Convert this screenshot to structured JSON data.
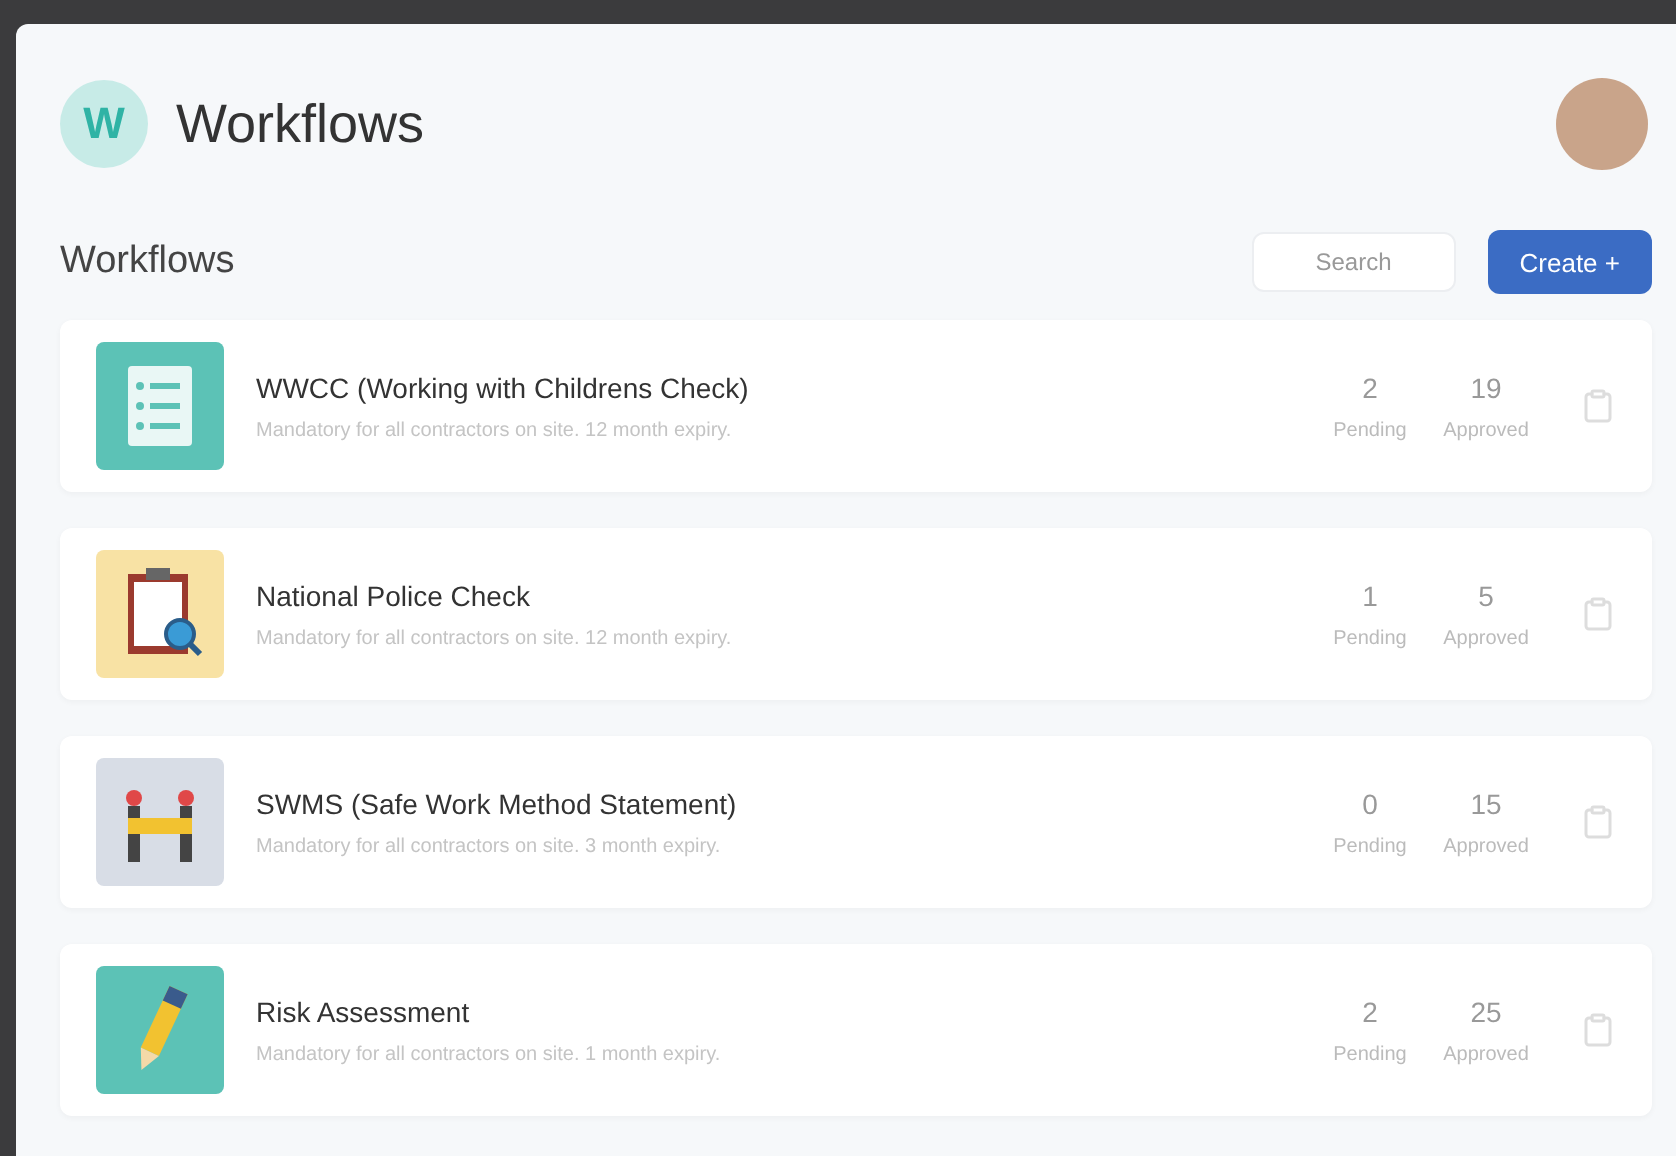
{
  "app": {
    "logo_letter": "W",
    "title": "Workflows"
  },
  "toolbar": {
    "heading": "Workflows",
    "search": {
      "placeholder": "Search"
    },
    "create_button": "Create +"
  },
  "workflows": [
    {
      "kind": "checklist",
      "title": "WWCC (Working with Childrens Check)",
      "description": "Mandatory for all contractors on site. 12 month expiry.",
      "pending": "2",
      "pending_label": "Pending",
      "approved": "19",
      "approved_label": "Approved"
    },
    {
      "kind": "police",
      "title": "National Police Check",
      "description": "Mandatory for all contractors on site. 12 month expiry.",
      "pending": "1",
      "pending_label": "Pending",
      "approved": "5",
      "approved_label": "Approved"
    },
    {
      "kind": "barrier",
      "title": "SWMS (Safe Work Method Statement)",
      "description": "Mandatory for all contractors on site. 3 month expiry.",
      "pending": "0",
      "pending_label": "Pending",
      "approved": "15",
      "approved_label": "Approved"
    },
    {
      "kind": "pencil",
      "title": "Risk Assessment",
      "description": "Mandatory for all contractors on site. 1 month expiry.",
      "pending": "2",
      "pending_label": "Pending",
      "approved": "25",
      "approved_label": "Approved"
    }
  ]
}
